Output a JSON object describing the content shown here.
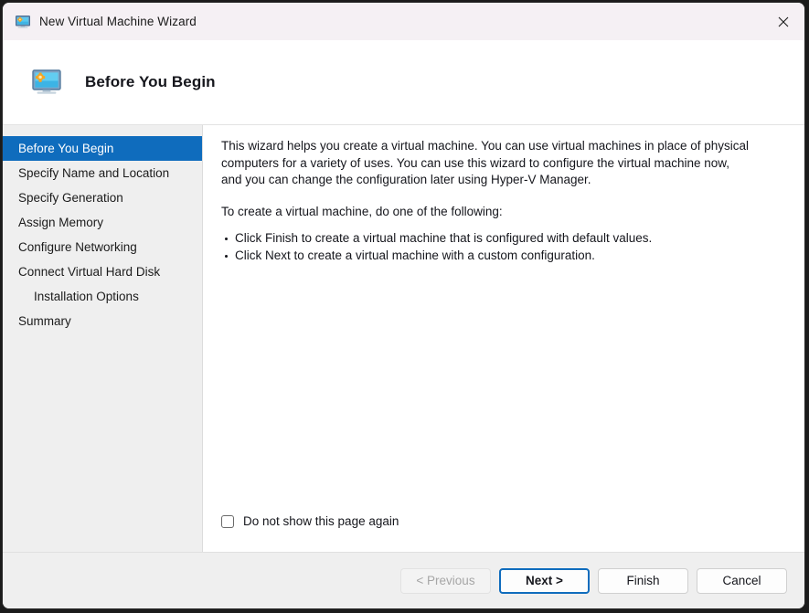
{
  "window": {
    "title": "New Virtual Machine Wizard",
    "icon": "virtual-machine-monitor-icon",
    "close_glyph": "✕"
  },
  "header": {
    "title": "Before You Begin",
    "icon": "virtual-machine-monitor-icon"
  },
  "sidebar": {
    "selected_color": "#0f6cbd",
    "items": [
      {
        "label": "Before You Begin",
        "selected": true,
        "indented": false
      },
      {
        "label": "Specify Name and Location",
        "selected": false,
        "indented": false
      },
      {
        "label": "Specify Generation",
        "selected": false,
        "indented": false
      },
      {
        "label": "Assign Memory",
        "selected": false,
        "indented": false
      },
      {
        "label": "Configure Networking",
        "selected": false,
        "indented": false
      },
      {
        "label": "Connect Virtual Hard Disk",
        "selected": false,
        "indented": false
      },
      {
        "label": "Installation Options",
        "selected": false,
        "indented": true
      },
      {
        "label": "Summary",
        "selected": false,
        "indented": false
      }
    ]
  },
  "content": {
    "paragraph1": "This wizard helps you create a virtual machine. You can use virtual machines in place of physical computers for a variety of uses. You can use this wizard to configure the virtual machine now, and you can change the configuration later using Hyper-V Manager.",
    "paragraph2": "To create a virtual machine, do one of the following:",
    "bullets": [
      "Click Finish to create a virtual machine that is configured with default values.",
      "Click Next to create a virtual machine with a custom configuration."
    ],
    "checkbox": {
      "label": "Do not show this page again",
      "checked": false
    }
  },
  "footer": {
    "buttons": [
      {
        "label": "< Previous",
        "state": "disabled"
      },
      {
        "label": "Next >",
        "state": "focused"
      },
      {
        "label": "Finish",
        "state": "normal"
      },
      {
        "label": "Cancel",
        "state": "normal"
      }
    ]
  }
}
